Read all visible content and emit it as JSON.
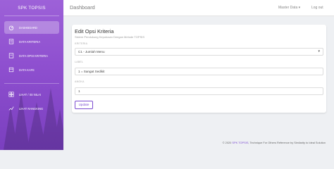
{
  "sidebar": {
    "brand": "SPK TOPSIS",
    "items": [
      {
        "label": "DASHBOARD",
        "icon": "dashboard-icon",
        "active": true
      },
      {
        "label": "DATA KRITERIA",
        "icon": "list-icon",
        "active": false
      },
      {
        "label": "DATA OPSI KRITERIA",
        "icon": "document-icon",
        "active": false
      },
      {
        "label": "DATA KAFE",
        "icon": "cafe-icon",
        "active": false
      },
      {
        "label": "LIHAT / ISI NILAI",
        "icon": "grid-icon",
        "active": false
      },
      {
        "label": "LIHAT RANGKING",
        "icon": "ranking-icon",
        "active": false
      }
    ]
  },
  "topbar": {
    "title": "Dashboard",
    "master_data": "Master Data ▾",
    "logout": "Log out"
  },
  "form": {
    "title": "Edit Opsi Kriteria",
    "subtitle": "Sistem Pendukung Keputusan Dengan Metode TOPSIS",
    "kriteria_label": "KRITERIA",
    "kriteria_value": "C1 - Jumlah Menu",
    "label_label": "LABEL",
    "label_value": "1 = Sangat Sedikit",
    "angka_label": "ANGKA",
    "angka_value": "1",
    "update_button": "Update"
  },
  "footer": {
    "prefix": "© 2020",
    "brand": "SPK TOPSIS",
    "suffix": ", Technique For Others Reference by Similarity to Ideal Solution"
  },
  "colors": {
    "accent": "#7b4bd0",
    "sidebar_top": "#9d61d8",
    "sidebar_bottom": "#7a3fbf"
  }
}
